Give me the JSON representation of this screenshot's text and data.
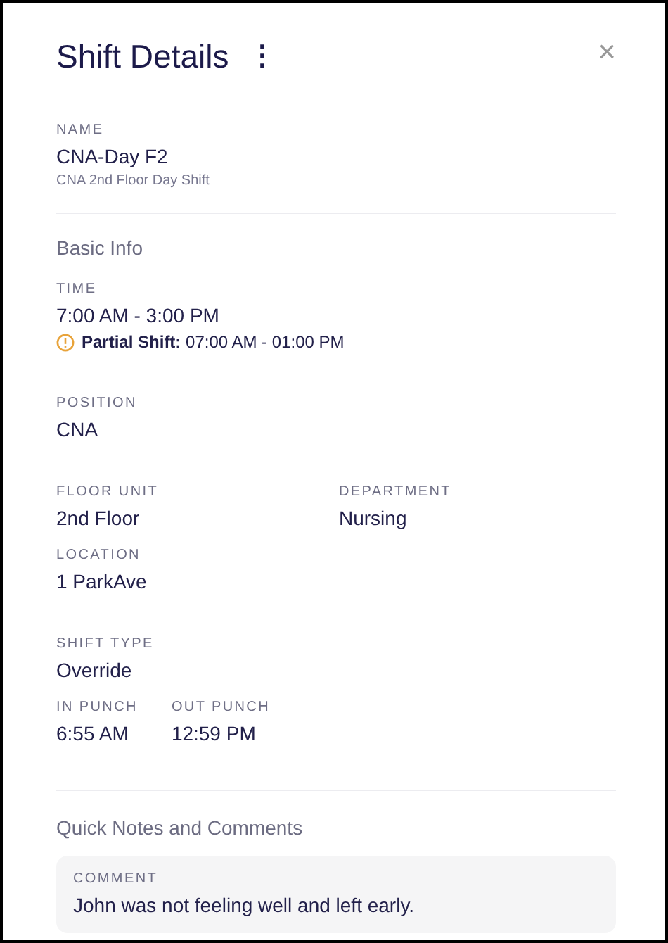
{
  "header": {
    "title": "Shift Details",
    "menu_icon": "⋮",
    "close_icon": "×"
  },
  "name": {
    "label": "NAME",
    "value": "CNA-Day F2",
    "description": "CNA 2nd Floor Day Shift"
  },
  "basic_info": {
    "heading": "Basic Info",
    "time": {
      "label": "TIME",
      "value": "7:00 AM - 3:00 PM",
      "warning": {
        "label": "Partial Shift:",
        "value": "07:00 AM - 01:00 PM"
      }
    },
    "rows": [
      {
        "fields": [
          {
            "label": "POSITION",
            "value": "CNA"
          }
        ]
      },
      {
        "fields": [
          {
            "label": "FLOOR UNIT",
            "value": "2nd Floor"
          },
          {
            "label": "DEPARTMENT",
            "value": "Nursing"
          }
        ]
      },
      {
        "fields": [
          {
            "label": "LOCATION",
            "value": "1 ParkAve"
          }
        ]
      },
      {
        "fields": [
          {
            "label": "SHIFT TYPE",
            "value": "Override"
          }
        ]
      },
      {
        "fields": [
          {
            "label": "IN PUNCH",
            "value": "6:55 AM"
          },
          {
            "label": "OUT PUNCH",
            "value": "12:59 PM"
          }
        ]
      }
    ]
  },
  "notes": {
    "heading": "Quick Notes and Comments",
    "comment": {
      "label": "COMMENT",
      "value": "John was not feeling well and left early."
    }
  }
}
